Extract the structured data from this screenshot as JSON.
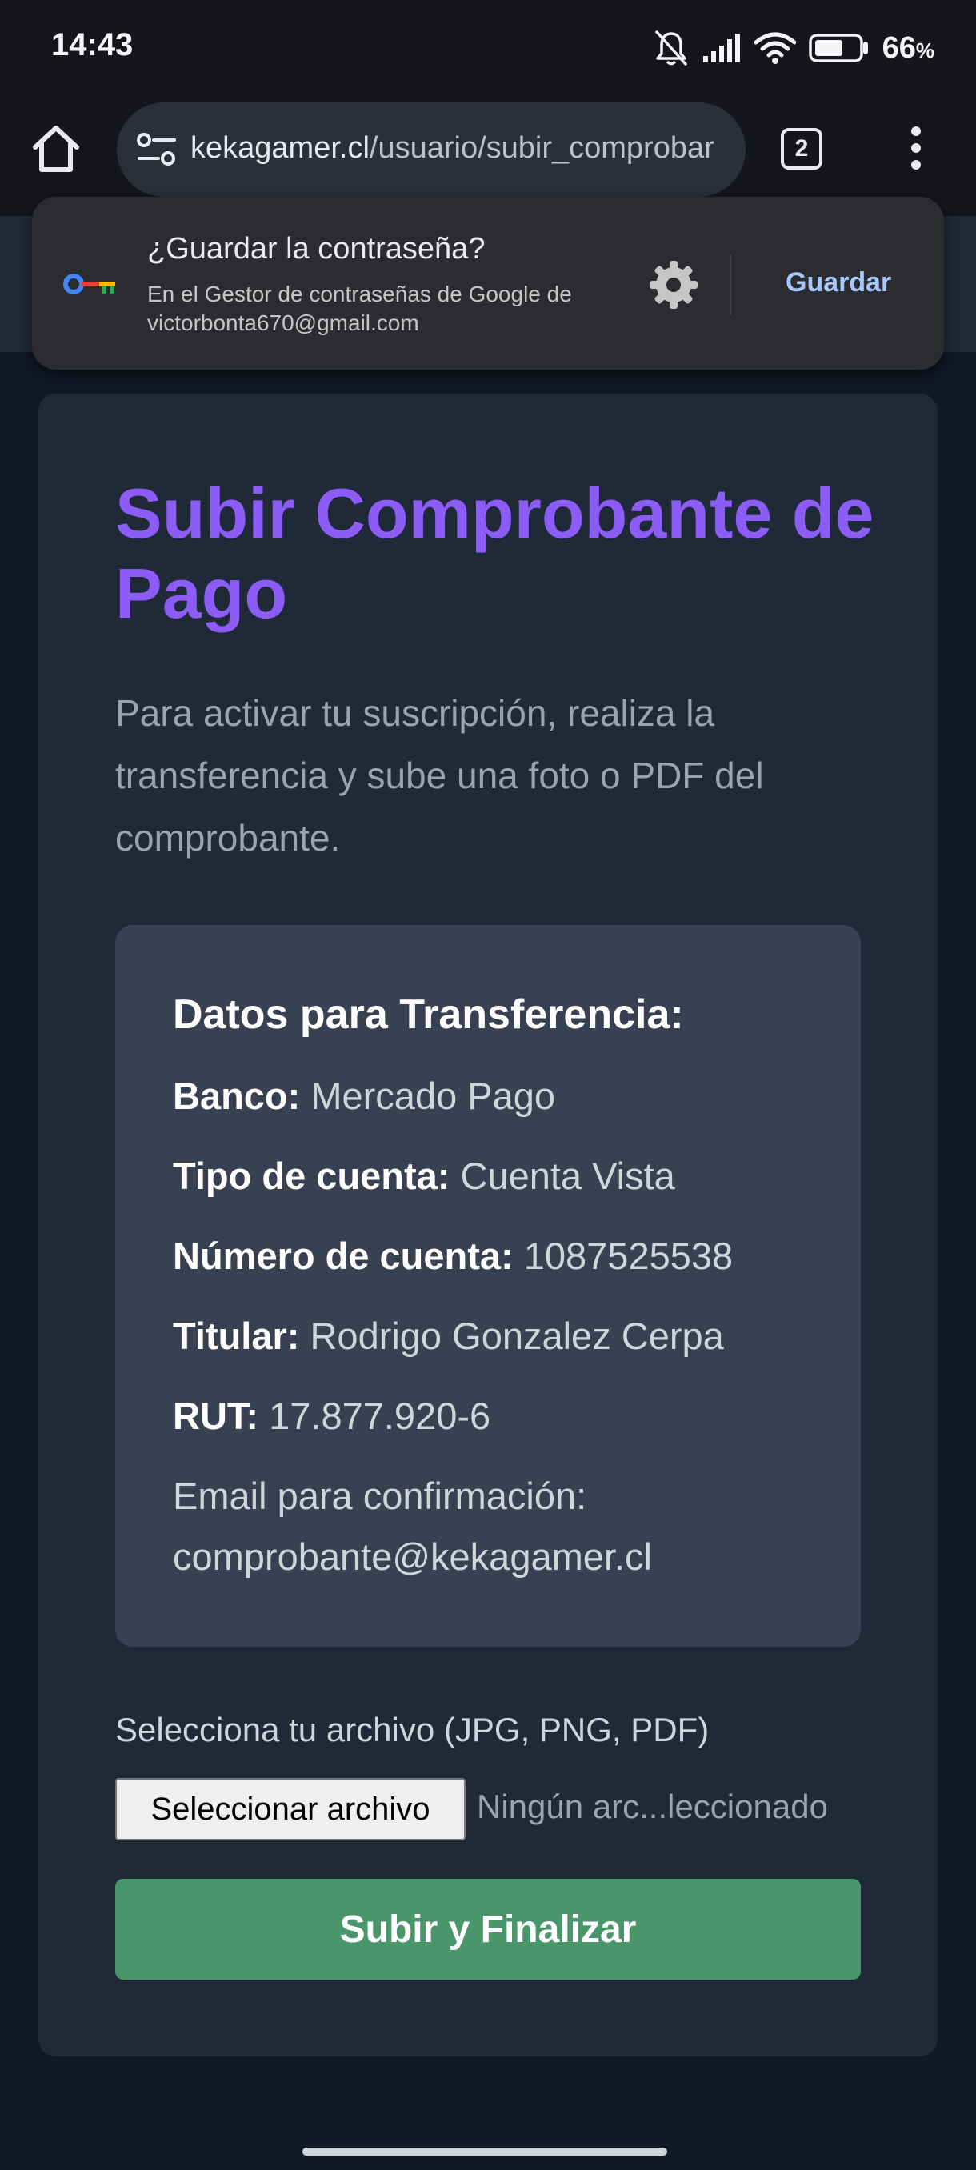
{
  "status_bar": {
    "time": "14:43",
    "icons": [
      "bell-off-icon",
      "signal-icon",
      "wifi-icon",
      "battery-icon"
    ],
    "battery_percent": "66",
    "battery_unit": "%",
    "battery_level": 0.66
  },
  "browser": {
    "url_domain": "kekagamer.cl",
    "url_path": "/usuario/subir_comprobar",
    "tab_count": "2"
  },
  "password_prompt": {
    "title": "¿Guardar la contraseña?",
    "subtitle": "En el Gestor de contraseñas de Google de victorbonta670@gmail.com",
    "save_label": "Guardar"
  },
  "page": {
    "title": "Subir Comprobante de Pago",
    "description": "Para activar tu suscripción, realiza la transferencia y sube una foto o PDF del comprobante.",
    "accent_color": "#8b5cf6"
  },
  "transfer": {
    "heading": "Datos para Transferencia:",
    "rows": [
      {
        "label": "Banco:",
        "value": "Mercado Pago"
      },
      {
        "label": "Tipo de cuenta:",
        "value": "Cuenta Vista"
      },
      {
        "label": "Número de cuenta:",
        "value": "1087525538"
      },
      {
        "label": "Titular:",
        "value": "Rodrigo Gonzalez Cerpa"
      },
      {
        "label": "RUT:",
        "value": "17.877.920-6"
      }
    ],
    "email_label": "Email para confirmación:",
    "email_value": "comprobante@kekagamer.cl"
  },
  "upload": {
    "label": "Selecciona tu archivo (JPG, PNG, PDF)",
    "button_label": "Seleccionar archivo",
    "file_status": "Ningún arc...leccionado",
    "submit_label": "Subir y Finalizar",
    "submit_color": "#48966a"
  }
}
